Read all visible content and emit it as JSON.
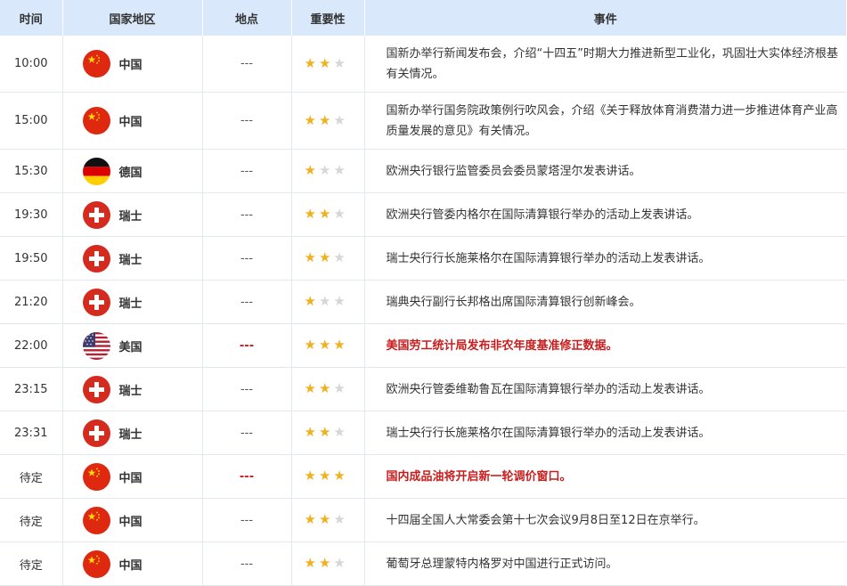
{
  "headers": {
    "time": "时间",
    "country": "国家地区",
    "place": "地点",
    "importance": "重要性",
    "event": "事件"
  },
  "colors": {
    "header_bg": "#d9e9fb",
    "highlight": "#c81d1d",
    "star": "#f2b01e",
    "star_empty": "#d6d6d6"
  },
  "rows": [
    {
      "time": "10:00",
      "country": "中国",
      "flag": "china-flag-icon",
      "place": "---",
      "stars": 2,
      "event": "国新办举行新闻发布会，介绍“十四五”时期大力推进新型工业化，巩固壮大实体经济根基有关情况。",
      "highlight": false
    },
    {
      "time": "15:00",
      "country": "中国",
      "flag": "china-flag-icon",
      "place": "---",
      "stars": 2,
      "event": "国新办举行国务院政策例行吹风会，介绍《关于释放体育消费潜力进一步推进体育产业高质量发展的意见》有关情况。",
      "highlight": false
    },
    {
      "time": "15:30",
      "country": "德国",
      "flag": "germany-flag-icon",
      "place": "---",
      "stars": 1,
      "event": "欧洲央行银行监管委员会委员蒙塔涅尔发表讲话。",
      "highlight": false
    },
    {
      "time": "19:30",
      "country": "瑞士",
      "flag": "switzerland-flag-icon",
      "place": "---",
      "stars": 2,
      "event": "欧洲央行管委内格尔在国际清算银行举办的活动上发表讲话。",
      "highlight": false
    },
    {
      "time": "19:50",
      "country": "瑞士",
      "flag": "switzerland-flag-icon",
      "place": "---",
      "stars": 2,
      "event": "瑞士央行行长施莱格尔在国际清算银行举办的活动上发表讲话。",
      "highlight": false
    },
    {
      "time": "21:20",
      "country": "瑞士",
      "flag": "switzerland-flag-icon",
      "place": "---",
      "stars": 1,
      "event": "瑞典央行副行长邦格出席国际清算银行创新峰会。",
      "highlight": false
    },
    {
      "time": "22:00",
      "country": "美国",
      "flag": "usa-flag-icon",
      "place": "---",
      "stars": 3,
      "event": "美国劳工统计局发布非农年度基准修正数据。",
      "highlight": true
    },
    {
      "time": "23:15",
      "country": "瑞士",
      "flag": "switzerland-flag-icon",
      "place": "---",
      "stars": 2,
      "event": "欧洲央行管委维勒鲁瓦在国际清算银行举办的活动上发表讲话。",
      "highlight": false
    },
    {
      "time": "23:31",
      "country": "瑞士",
      "flag": "switzerland-flag-icon",
      "place": "---",
      "stars": 2,
      "event": "瑞士央行行长施莱格尔在国际清算银行举办的活动上发表讲话。",
      "highlight": false
    },
    {
      "time": "待定",
      "country": "中国",
      "flag": "china-flag-icon",
      "place": "---",
      "stars": 3,
      "event": "国内成品油将开启新一轮调价窗口。",
      "highlight": true
    },
    {
      "time": "待定",
      "country": "中国",
      "flag": "china-flag-icon",
      "place": "---",
      "stars": 2,
      "event": "十四届全国人大常委会第十七次会议9月8日至12日在京举行。",
      "highlight": false
    },
    {
      "time": "待定",
      "country": "中国",
      "flag": "china-flag-icon",
      "place": "---",
      "stars": 2,
      "event": "葡萄牙总理蒙特内格罗对中国进行正式访问。",
      "highlight": false
    }
  ]
}
